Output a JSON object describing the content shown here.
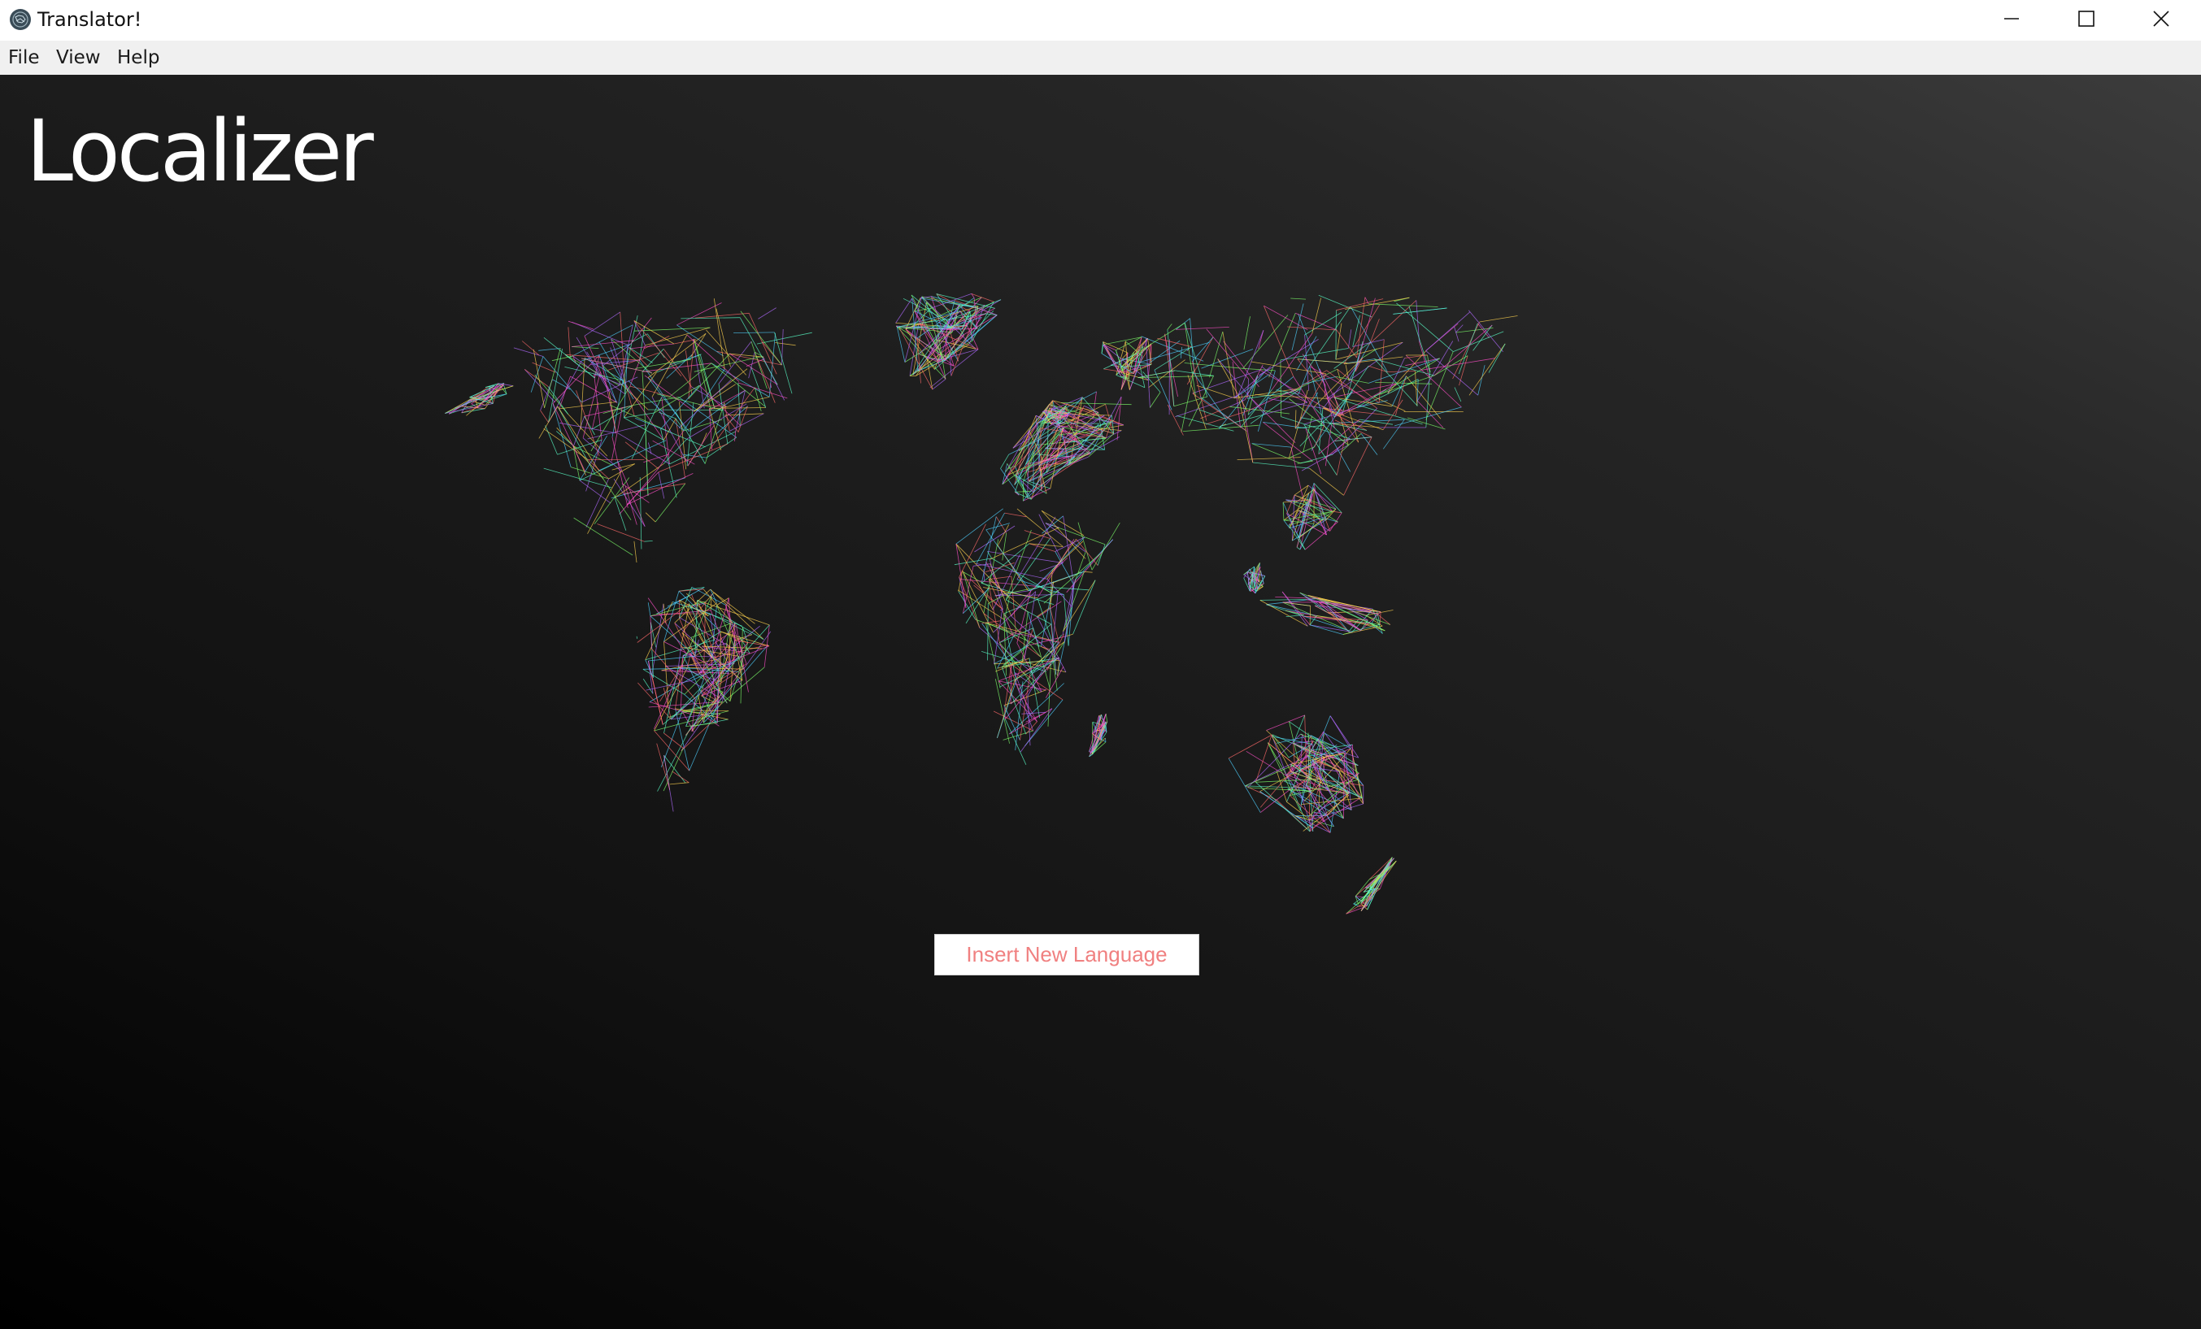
{
  "window": {
    "title": "Translator!",
    "controls": {
      "minimize_icon": "minimize-icon",
      "maximize_icon": "maximize-icon",
      "close_icon": "close-icon"
    }
  },
  "menu": {
    "items": [
      {
        "label": "File"
      },
      {
        "label": "View"
      },
      {
        "label": "Help"
      }
    ]
  },
  "main": {
    "title": "Localizer",
    "map_icon": "world-map-icon",
    "insert_button_label": "Insert New Language"
  },
  "colors": {
    "background_dark": "#000000",
    "background_light": "#3c3c3c",
    "button_text": "#f08080",
    "title_text": "#ffffff",
    "map_line_palette": [
      "#ff4fc8",
      "#4fd0ff",
      "#7dff6a",
      "#ffd34f",
      "#b06aff",
      "#ff6a6a",
      "#5affc8"
    ]
  }
}
